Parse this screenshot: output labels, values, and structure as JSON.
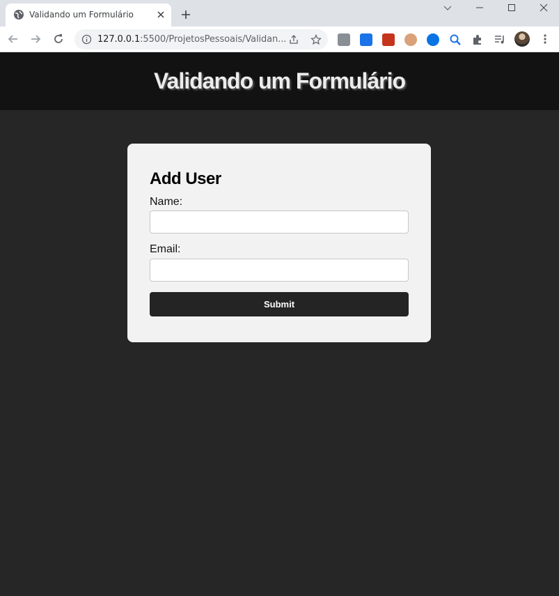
{
  "browser": {
    "tab": {
      "title": "Validando um Formulário"
    },
    "address_bar": {
      "host": "127.0.0.1",
      "rest": ":5500/ProjetosPessoais/Validan..."
    },
    "extensions": [
      "code-extension",
      "translate-extension",
      "video-speed-extension",
      "owl-extension",
      "media-player-extension",
      "search-extension",
      "puzzle-extensions",
      "media-list",
      "profile-avatar"
    ]
  },
  "page": {
    "header": {
      "title": "Validando um Formulário"
    },
    "form": {
      "heading": "Add User",
      "name": {
        "label": "Name:",
        "value": ""
      },
      "email": {
        "label": "Email:",
        "value": ""
      },
      "submit_label": "Submit"
    }
  }
}
